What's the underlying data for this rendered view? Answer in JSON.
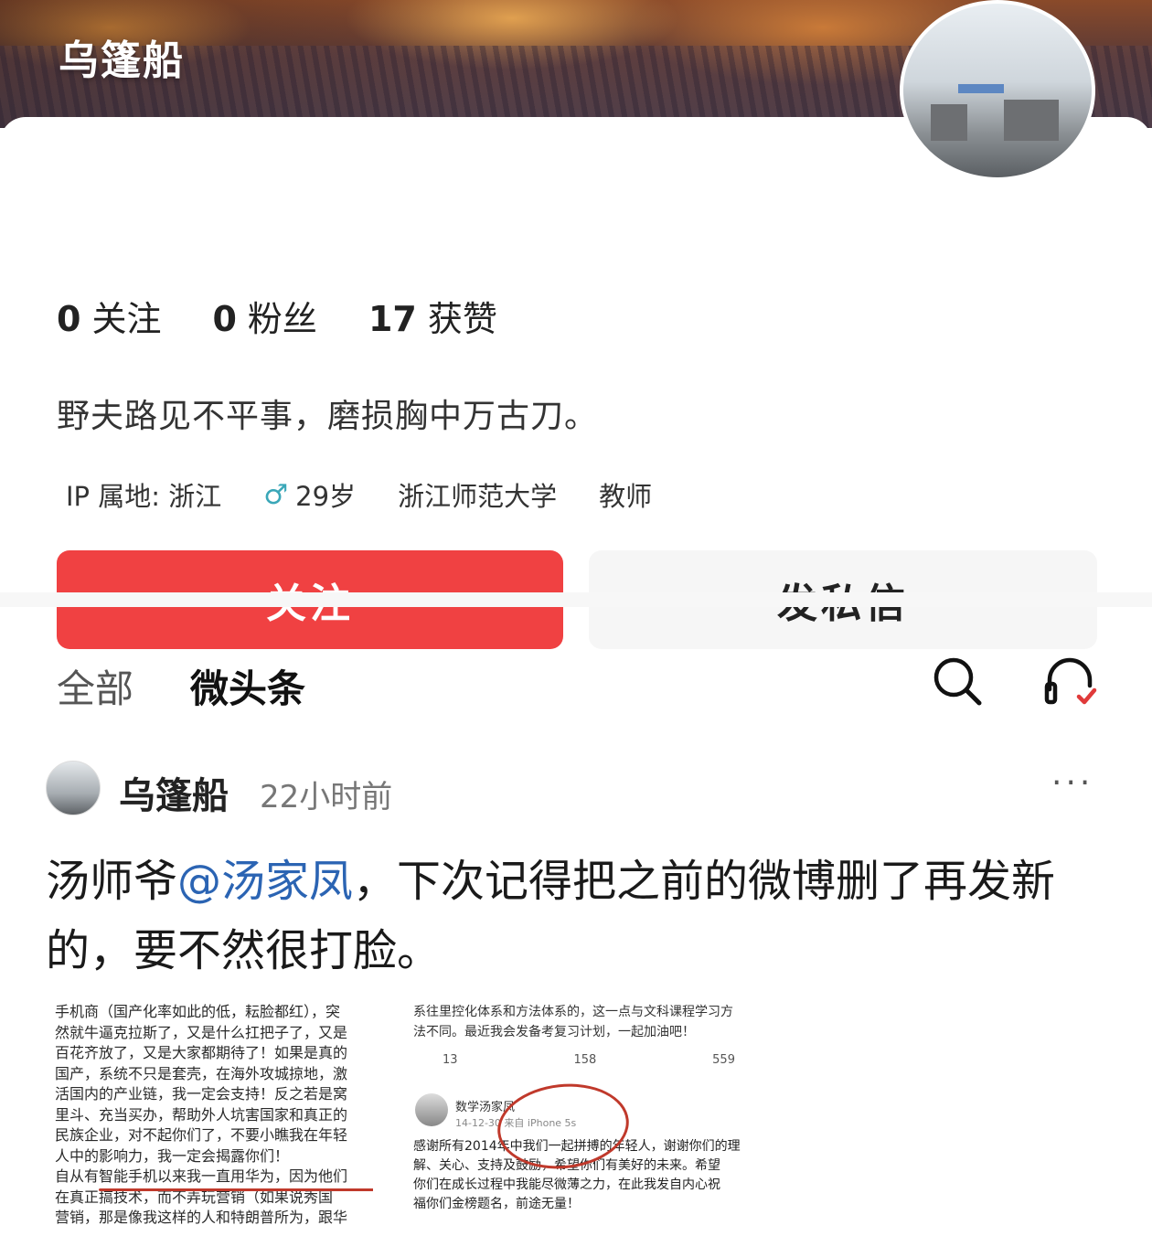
{
  "header": {
    "name": "乌篷船"
  },
  "stats": [
    {
      "num": "0",
      "label": "关注"
    },
    {
      "num": "0",
      "label": "粉丝"
    },
    {
      "num": "17",
      "label": "获赞"
    }
  ],
  "bio": "野夫路见不平事，磨损胸中万古刀。",
  "meta": {
    "ip": "IP 属地: 浙江",
    "gender_symbol": "♂",
    "age": "29岁",
    "school": "浙江师范大学",
    "job": "教师"
  },
  "actions": {
    "follow": "关注",
    "message": "发私信"
  },
  "tabs": {
    "all": "全部",
    "weitoutiao": "微头条"
  },
  "icons": {
    "search": "search-icon",
    "headset": "headset-icon",
    "more": "more-icon"
  },
  "post": {
    "author": "乌篷船",
    "time": "22小时前",
    "more": "···",
    "text_prefix": "汤师爷",
    "mention": "@汤家凤",
    "text_suffix": "，下次记得把之前的微博删了再发新的，要不然很打脸。",
    "image1_lines": [
      "手机商（国产化率如此的低，耘脸都红），突",
      "然就牛逼克拉斯了，又是什么扛把子了，又是",
      "百花齐放了，又是大家都期待了！如果是真的",
      "国产，系统不只是套壳，在海外攻城掠地，激",
      "活国内的产业链，我一定会支持！反之若是窝",
      "里斗、充当买办，帮助外人坑害国家和真正的",
      "民族企业，对不起你们了，不要小瞧我在年轻",
      "人中的影响力，我一定会揭露你们！",
      "自从有智能手机以来我一直用华为，因为他们",
      "在真正搞技术，而不弄玩营销（如果说秀国",
      "营销，那是像我这样的人和特朗普所为，跟华"
    ],
    "image2_top": [
      "系往里控化体系和方法体系的，这一点与文科课程学习方",
      "法不同。最近我会发备考复习计划，一起加油吧！"
    ],
    "image2_stats": [
      "13",
      "158",
      "559"
    ],
    "image2_name": "数学汤家凤",
    "image2_sub": "14-12-30  来自 iPhone 5s",
    "image2_body": [
      "感谢所有2014年中我们一起拼搏的年轻人，谢谢你们的理",
      "解、关心、支持及鼓励，希望你们有美好的未来。希望",
      "你们在成长过程中我能尽微薄之力，在此我发自内心祝",
      "福你们金榜题名，前途无量！"
    ]
  }
}
